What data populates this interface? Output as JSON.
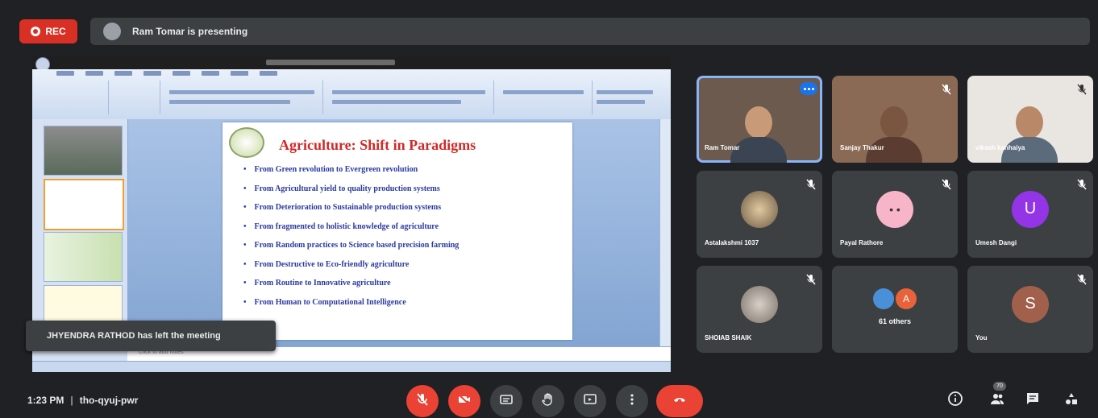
{
  "header": {
    "rec_label": "REC",
    "presenting_text": "Ram Tomar is presenting"
  },
  "slide": {
    "title": "Agriculture: Shift in Paradigms",
    "bullets": [
      "From Green revolution to Evergreen revolution",
      "From Agricultural yield to quality production systems",
      "From Deterioration to Sustainable production systems",
      "From fragmented to holistic knowledge of agriculture",
      "From Random practices to Science based precision farming",
      "From Destructive to Eco-friendly agriculture",
      "From Routine to Innovative agriculture",
      "From Human to Computational Intelligence"
    ],
    "notes_placeholder": "Click to add notes"
  },
  "toast": {
    "text": "JHYENDRA RATHOD has left the meeting"
  },
  "participants": [
    {
      "name": "Ram Tomar",
      "type": "video"
    },
    {
      "name": "Sanjay Thakur",
      "type": "video"
    },
    {
      "name": "vikash kanhaiya",
      "type": "video"
    },
    {
      "name": "Astalakshmi 1037",
      "type": "photo"
    },
    {
      "name": "Payal Rathore",
      "type": "avatar"
    },
    {
      "name": "Umesh Dangi",
      "type": "letter",
      "letter": "U",
      "color": "#9334e6"
    },
    {
      "name": "SHOIAB SHAIK",
      "type": "photo"
    },
    {
      "name": "61 others",
      "type": "others",
      "letter": "A"
    },
    {
      "name": "You",
      "type": "letter",
      "letter": "S",
      "color": "#a1604b"
    }
  ],
  "footer": {
    "time": "1:23 PM",
    "meeting_code": "tho-qyuj-pwr",
    "participant_count": "70"
  },
  "colors": {
    "background": "#202124",
    "tile": "#3c4043",
    "danger": "#ea4335",
    "accent": "#1a73e8"
  },
  "icons": [
    "mic-off-icon",
    "camera-off-icon",
    "captions-icon",
    "raise-hand-icon",
    "present-icon",
    "more-options-icon",
    "hang-up-icon",
    "info-icon",
    "people-icon",
    "chat-icon",
    "activities-icon"
  ]
}
